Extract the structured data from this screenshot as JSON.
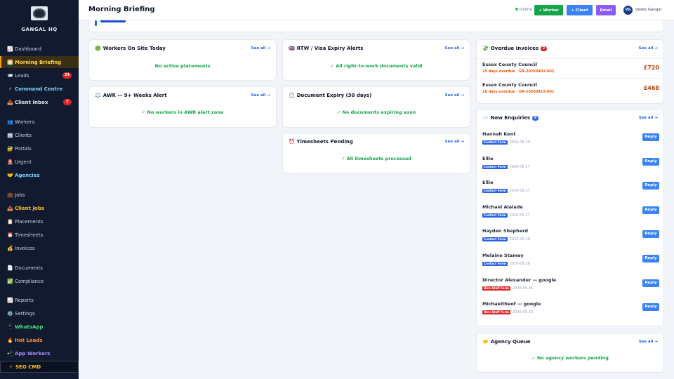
{
  "app": {
    "brand": "GANGAL HQ"
  },
  "header": {
    "title": "Morning Briefing",
    "status": "Online",
    "buttons": {
      "worker": "+ Worker",
      "client": "+ Client",
      "email": "Email"
    },
    "user": {
      "initials": "VG",
      "name": "Vasile Gangal"
    }
  },
  "sidebar": {
    "items": [
      {
        "icon": "📈",
        "label": "Dashboard"
      },
      {
        "icon": "🌅",
        "label": "Morning Briefing"
      },
      {
        "icon": "📨",
        "label": "Leads",
        "count": "24"
      },
      {
        "icon": "⚡",
        "label": "Command Centre"
      },
      {
        "icon": "📥",
        "label": "Client Inbox",
        "count": "2"
      },
      {
        "icon": "👥",
        "label": "Workers"
      },
      {
        "icon": "🏢",
        "label": "Clients"
      },
      {
        "icon": "🔐",
        "label": "Portals"
      },
      {
        "icon": "🚨",
        "label": "Urgent"
      },
      {
        "icon": "🤝",
        "label": "Agencies"
      },
      {
        "icon": "💼",
        "label": "Jobs"
      },
      {
        "icon": "📥",
        "label": "Client Jobs"
      },
      {
        "icon": "📋",
        "label": "Placements"
      },
      {
        "icon": "⏰",
        "label": "Timesheets"
      },
      {
        "icon": "💰",
        "label": "Invoices"
      },
      {
        "icon": "📄",
        "label": "Documents"
      },
      {
        "icon": "✅",
        "label": "Compliance"
      },
      {
        "icon": "📈",
        "label": "Reports"
      },
      {
        "icon": "⚙️",
        "label": "Settings"
      },
      {
        "icon": "📱",
        "label": "WhatsApp"
      },
      {
        "icon": "🔥",
        "label": "Hot Leads"
      },
      {
        "icon": "📲",
        "label": "App Workers"
      },
      {
        "icon": "⚡",
        "label": "SEO CMD"
      }
    ]
  },
  "cards": {
    "workers_on_site": {
      "icon": "🟢",
      "title": "Workers On Site Today",
      "see_all": "See all →",
      "empty": "No active placements"
    },
    "rtw": {
      "icon": "🇬🇧",
      "title": "RTW / Visa Expiry Alerts",
      "see_all": "See all →",
      "empty": "✓ All right-to-work documents valid"
    },
    "awr": {
      "icon": "⚖️",
      "title": "AWR — 9+ Weeks Alert",
      "see_all": "See all →",
      "empty": "✓ No workers in AWR alert zone"
    },
    "doc_expiry": {
      "icon": "📋",
      "title": "Document Expiry (30 days)",
      "see_all": "See all →",
      "empty": "✓ No documents expiring soon"
    },
    "timesheets": {
      "icon": "⏰",
      "title": "Timesheets Pending",
      "see_all": "See all →",
      "empty": "✓ All timesheets processed"
    },
    "overdue": {
      "icon": "💸",
      "title": "Overdue Invoices",
      "count": "2",
      "see_all": "See all →",
      "rows": [
        {
          "client": "Essex County Council",
          "detail": "25 days overdue · GR-20260402-002",
          "amount": "£720"
        },
        {
          "client": "Essex County Council",
          "detail": "18 days overdue · GR-20260415-001",
          "amount": "£468"
        }
      ]
    },
    "enquiries": {
      "icon": "📨",
      "title": "New Enquiries",
      "count": "8",
      "see_all": "See all →",
      "reply_label": "Reply",
      "rows": [
        {
          "name": "Hannah Kent",
          "source": "Contact Form",
          "date": "2026-05-29"
        },
        {
          "name": "Ellie",
          "source": "Contact Form",
          "date": "2026-05-27"
        },
        {
          "name": "Ellie",
          "source": "Contact Form",
          "date": "2026-05-27"
        },
        {
          "name": "Michael Alalade",
          "source": "Contact Form",
          "date": "2026-05-27"
        },
        {
          "name": "Hayden Shepherd",
          "source": "Contact Form",
          "date": "2026-05-26"
        },
        {
          "name": "Melaine Stamey",
          "source": "Contact Form",
          "date": "2026-05-26"
        },
        {
          "name": "Director Alexander — google",
          "source": "Hire Staff Form",
          "date": "2026-05-25"
        },
        {
          "name": "Michaeltheof — google",
          "source": "Hire Staff Form",
          "date": "2026-05-25"
        }
      ]
    },
    "agency_queue": {
      "icon": "🤝",
      "title": "Agency Queue",
      "see_all": "See all →",
      "empty": "✓ No agency workers pending"
    }
  },
  "colors": {
    "accent": "#2563eb",
    "success": "#16a34a",
    "danger": "#dc2626",
    "warning": "#f59e0b",
    "sidebar": "#111a2e"
  }
}
